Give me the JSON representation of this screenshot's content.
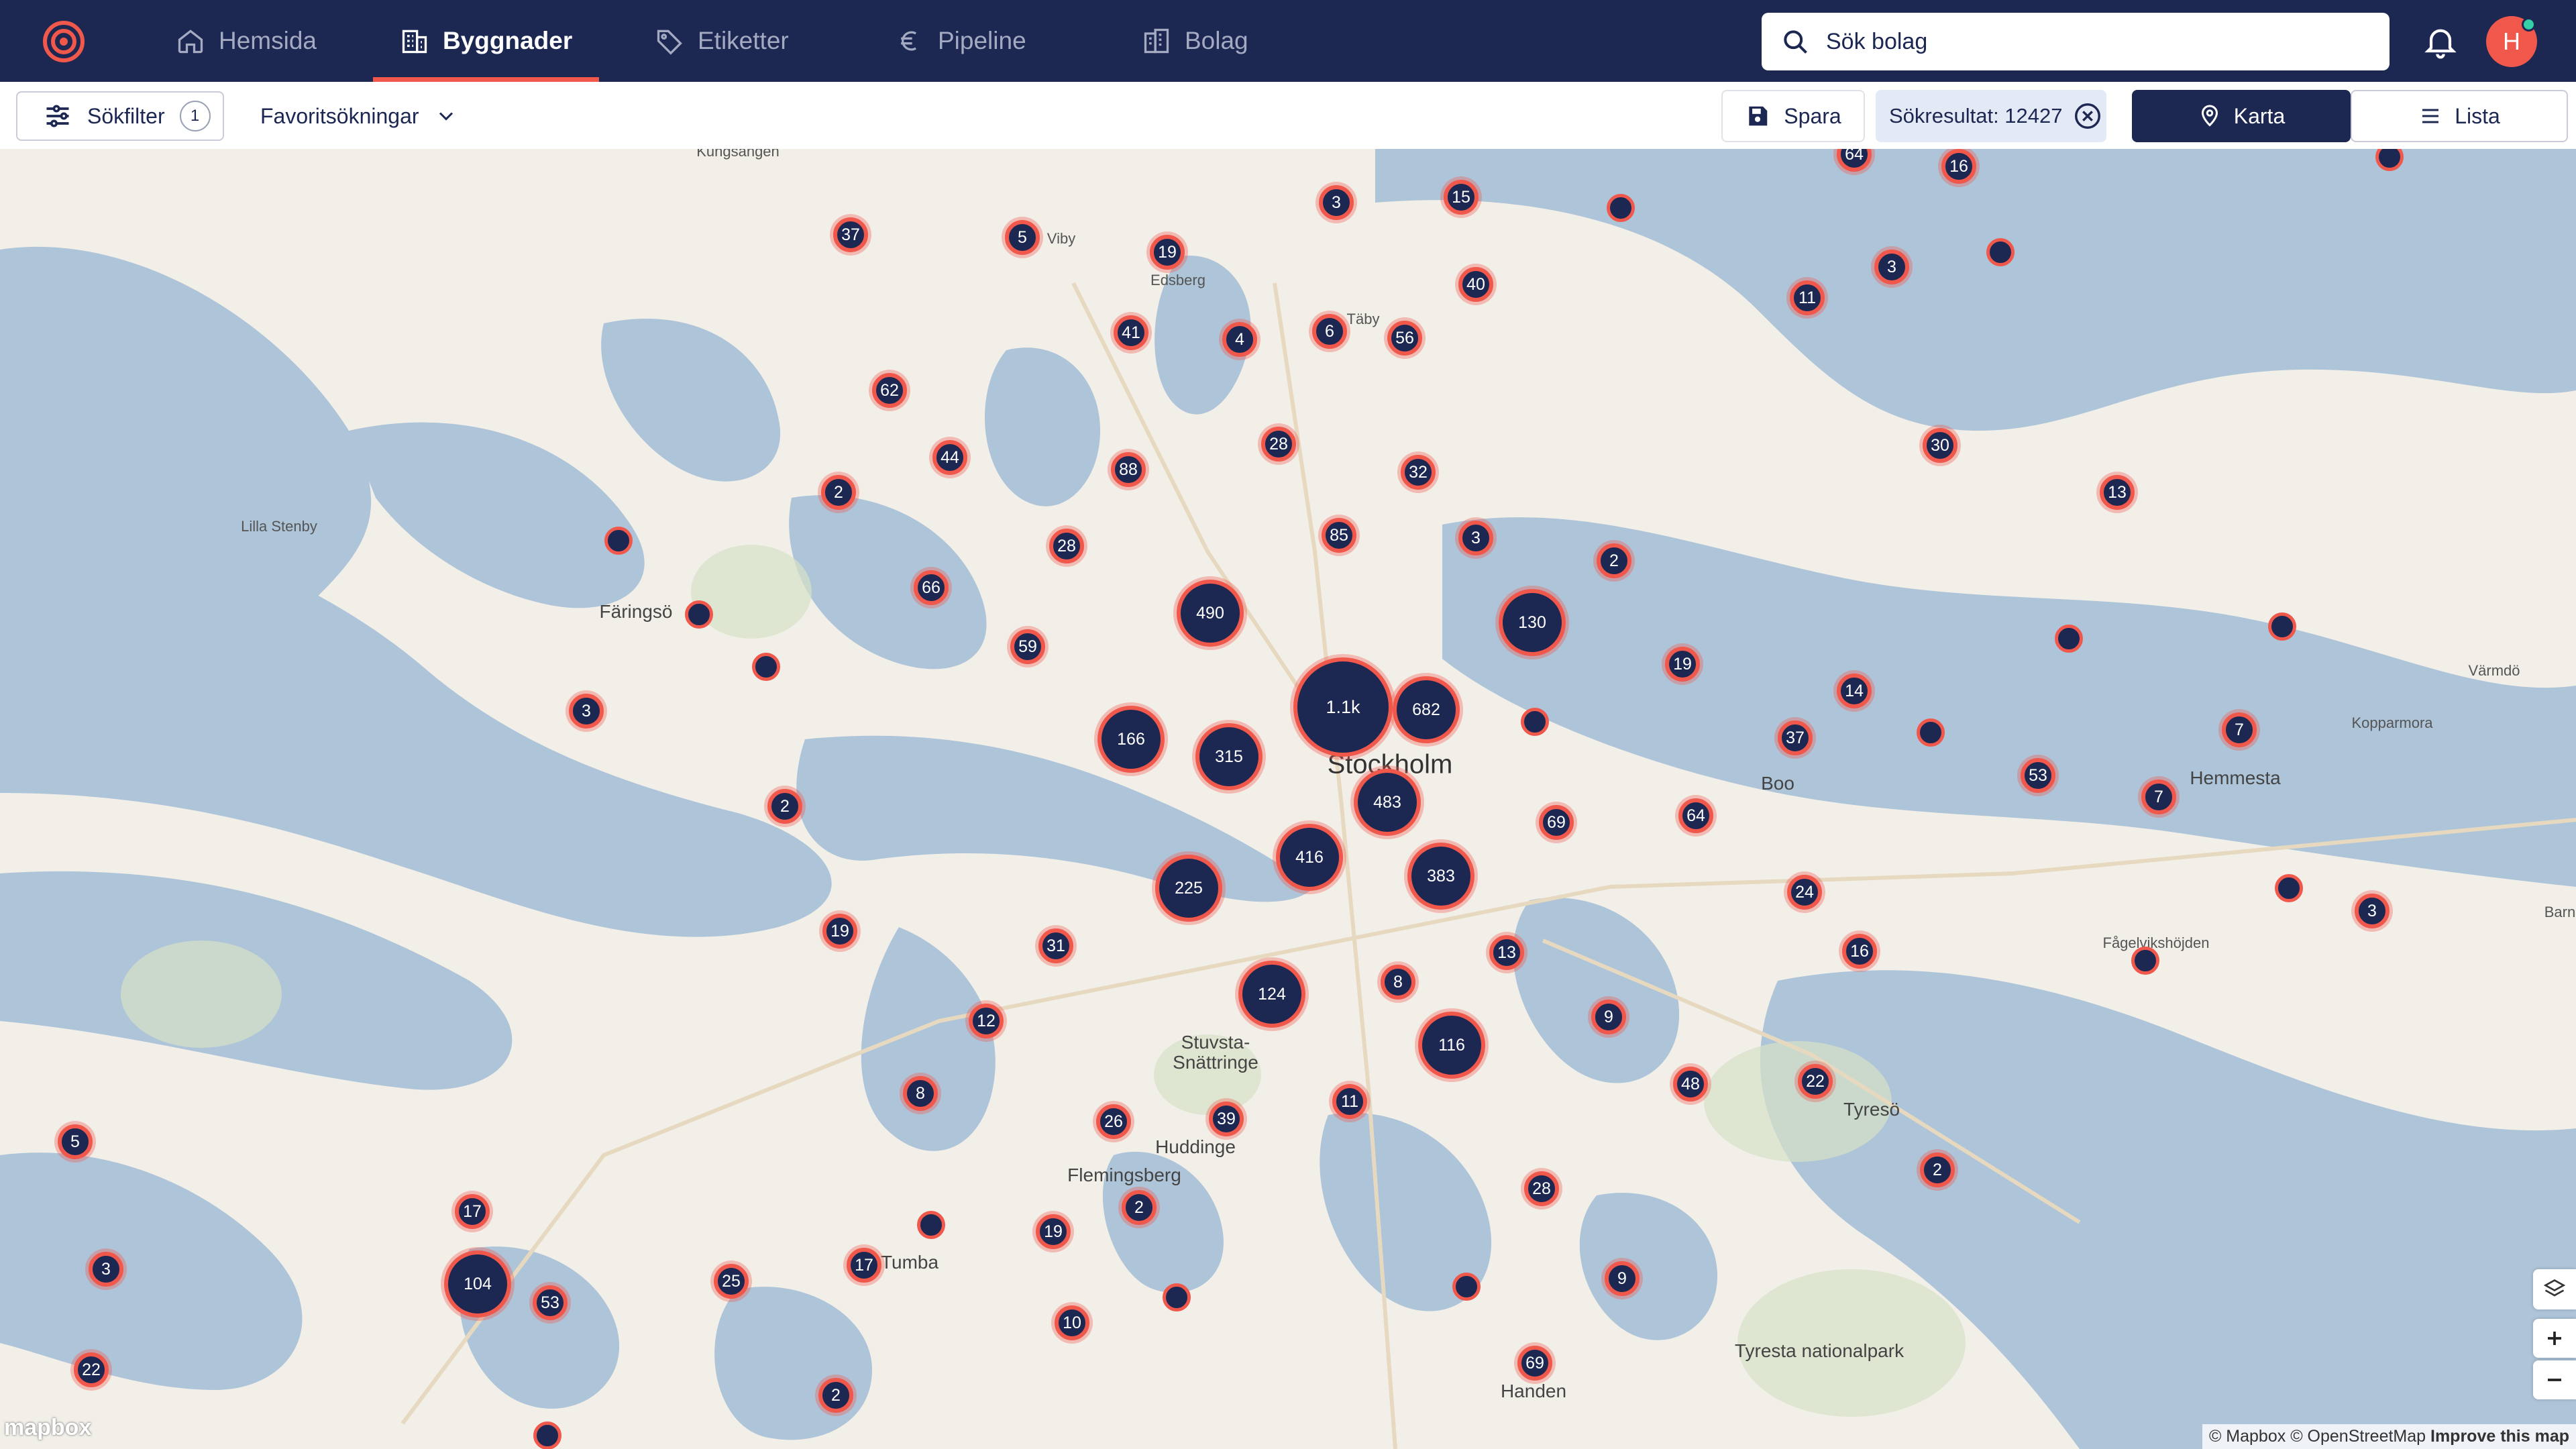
{
  "nav": {
    "items": [
      {
        "label": "Hemsida",
        "icon": "home-icon"
      },
      {
        "label": "Byggnader",
        "icon": "building-icon",
        "active": true
      },
      {
        "label": "Etiketter",
        "icon": "tag-icon"
      },
      {
        "label": "Pipeline",
        "icon": "euro-icon"
      },
      {
        "label": "Bolag",
        "icon": "company-icon"
      }
    ],
    "search_placeholder": "Sök bolag",
    "avatar_initial": "H"
  },
  "toolbar": {
    "filter_label": "Sökfilter",
    "filter_count": "1",
    "favorites_label": "Favoritsökningar",
    "save_label": "Spara",
    "results_label": "Sökresultat: 12427",
    "map_label": "Karta",
    "list_label": "Lista"
  },
  "map": {
    "places": [
      {
        "name": "Kungsängen"
      },
      {
        "name": "Viby"
      },
      {
        "name": "Edsberg"
      },
      {
        "name": "Täby"
      },
      {
        "name": "Lilla Stenby"
      },
      {
        "name": "Färingsö"
      },
      {
        "name": "Stockholm"
      },
      {
        "name": "Boo"
      },
      {
        "name": "Värmdö"
      },
      {
        "name": "Kopparmora"
      },
      {
        "name": "Hemmesta"
      },
      {
        "name": "Fågelvikshöjden"
      },
      {
        "name": "Barn"
      },
      {
        "name": "Stuvsta-"
      },
      {
        "name": "Snättringe"
      },
      {
        "name": "Huddinge"
      },
      {
        "name": "Flemingsberg"
      },
      {
        "name": "Tumba"
      },
      {
        "name": "Tyresö"
      },
      {
        "name": "Tyresta nationalpark"
      },
      {
        "name": "Handen"
      }
    ],
    "clusters": [
      "64",
      "16",
      "3",
      "15",
      "37",
      "5",
      "19",
      "3",
      "11",
      "41",
      "4",
      "6",
      "56",
      "40",
      "62",
      "44",
      "28",
      "30",
      "13",
      "2",
      "88",
      "32",
      "85",
      "3",
      "28",
      "2",
      "66",
      "490",
      "130",
      "59",
      "19",
      "14",
      "1.1k",
      "682",
      "166",
      "315",
      "37",
      "3",
      "2",
      "483",
      "69",
      "64",
      "53",
      "7",
      "7",
      "416",
      "383",
      "225",
      "24",
      "13",
      "3",
      "19",
      "31",
      "16",
      "8",
      "12",
      "124",
      "116",
      "9",
      "8",
      "48",
      "22",
      "26",
      "39",
      "11",
      "2",
      "28",
      "5",
      "17",
      "19",
      "2",
      "17",
      "104",
      "3",
      "25",
      "53",
      "10",
      "9",
      "22",
      "69",
      "2"
    ],
    "attribution": "© Mapbox © OpenStreetMap",
    "improve_label": "Improve this map",
    "mapbox_label": "mapbox"
  }
}
